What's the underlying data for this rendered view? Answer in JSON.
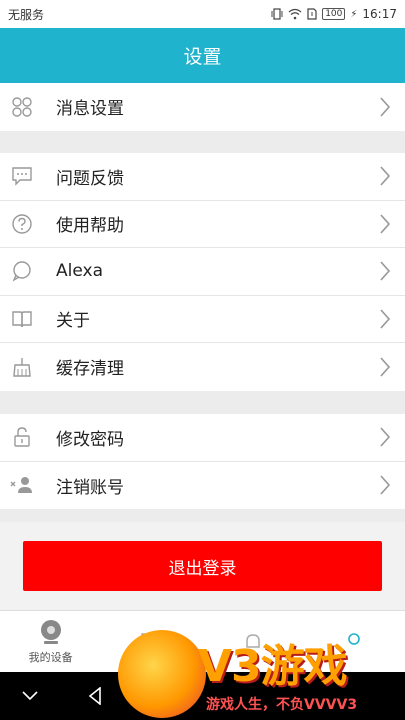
{
  "status": {
    "carrier": "无服务",
    "battery": "100",
    "time": "16:17"
  },
  "header": {
    "title": "设置"
  },
  "groups": [
    {
      "items": [
        {
          "label": "消息设置",
          "icon": "grid-icon"
        }
      ]
    },
    {
      "items": [
        {
          "label": "问题反馈",
          "icon": "chat-icon"
        },
        {
          "label": "使用帮助",
          "icon": "help-icon"
        },
        {
          "label": "Alexa",
          "icon": "speech-bubble-icon"
        },
        {
          "label": "关于",
          "icon": "book-icon"
        },
        {
          "label": "缓存清理",
          "icon": "broom-icon"
        }
      ]
    },
    {
      "items": [
        {
          "label": "修改密码",
          "icon": "lock-icon"
        },
        {
          "label": "注销账号",
          "icon": "remove-user-icon"
        }
      ]
    }
  ],
  "logout": {
    "label": "退出登录"
  },
  "tabs": [
    {
      "label": "我的设备"
    }
  ],
  "watermark": {
    "brand": "V3游戏",
    "slogan": "游戏人生，不负VVVV3"
  },
  "colors": {
    "accent": "#1fb3cd",
    "logout": "#ff0000"
  }
}
